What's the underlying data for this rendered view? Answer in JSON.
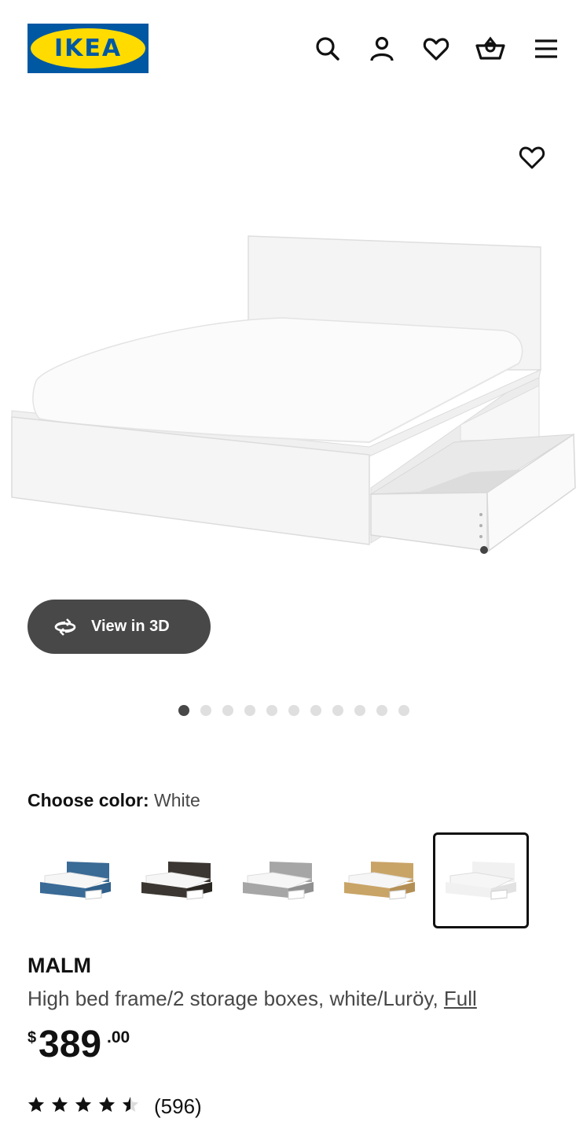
{
  "brand": {
    "logo_text": "IKEA",
    "blue": "#0058a3",
    "yellow": "#ffdb00"
  },
  "header": {
    "icons": [
      "search-icon",
      "account-icon",
      "heart-icon",
      "cart-icon",
      "menu-icon"
    ]
  },
  "gallery": {
    "view_3d_label": "View in 3D",
    "dot_count": 11,
    "active_dot": 0
  },
  "color_picker": {
    "label": "Choose color:",
    "selected_value": "White",
    "options": [
      {
        "name": "blue",
        "frame": "#3a6a96",
        "accent": "#2f5f8a"
      },
      {
        "name": "black-brown",
        "frame": "#3b3631",
        "accent": "#2a2622"
      },
      {
        "name": "gray",
        "frame": "#a6a6a6",
        "accent": "#909090"
      },
      {
        "name": "oak veneer",
        "frame": "#c9a467",
        "accent": "#b48f55"
      },
      {
        "name": "white",
        "frame": "#f1f1f1",
        "accent": "#e2e2e2"
      }
    ],
    "selected_index": 4
  },
  "product": {
    "name": "MALM",
    "description": "High bed frame/2 storage boxes, white/Luröy, ",
    "size_link": "Full",
    "price_currency": "$",
    "price_integer": "389",
    "price_decimal": ".00",
    "rating": 4.5,
    "review_count": "(596)"
  }
}
